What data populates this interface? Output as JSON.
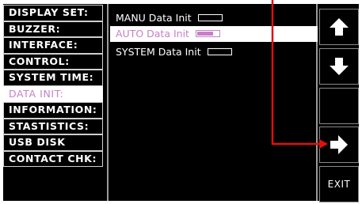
{
  "menu": {
    "items": [
      {
        "label": "DISPLAY SET:",
        "active": false
      },
      {
        "label": "BUZZER:",
        "active": false
      },
      {
        "label": "INTERFACE:",
        "active": false
      },
      {
        "label": "CONTROL:",
        "active": false
      },
      {
        "label": "SYSTEM TIME:",
        "active": false
      },
      {
        "label": "DATA INIT:",
        "active": true
      },
      {
        "label": "INFORMATION:",
        "active": false
      },
      {
        "label": "STASTISTICS:",
        "active": false
      },
      {
        "label": "USB DISK",
        "active": false
      },
      {
        "label": "CONTACT CHK:",
        "active": false
      }
    ]
  },
  "content": {
    "options": [
      {
        "label": "MANU Data Init",
        "selected": false,
        "checked": false
      },
      {
        "label": "AUTO Data Init",
        "selected": true,
        "checked": true
      },
      {
        "label": "SYSTEM Data Init",
        "selected": false,
        "checked": false
      }
    ]
  },
  "softkeys": {
    "up": "arrow-up-icon",
    "down": "arrow-down-icon",
    "right": "arrow-right-icon",
    "exit_label": "EXIT"
  },
  "colors": {
    "highlight_text": "#c77fc7",
    "callout": "#e01010",
    "background": "#000000"
  }
}
